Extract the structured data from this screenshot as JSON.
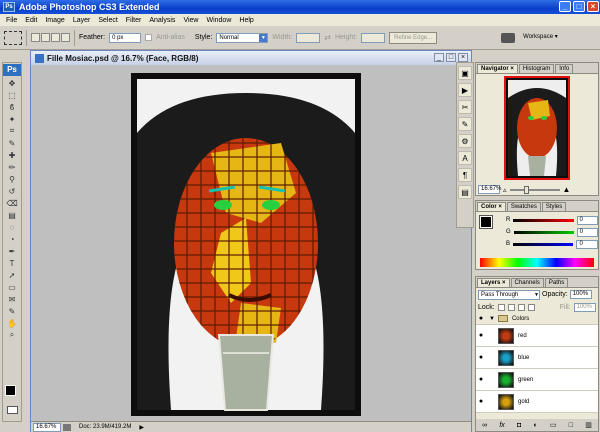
{
  "app": {
    "title": "Adobe Photoshop CS3 Extended",
    "logo": "Ps",
    "window_buttons": [
      "_",
      "□",
      "×"
    ]
  },
  "menu": [
    "File",
    "Edit",
    "Image",
    "Layer",
    "Select",
    "Filter",
    "Analysis",
    "View",
    "Window",
    "Help"
  ],
  "options": {
    "feather_label": "Feather:",
    "feather_value": "0 px",
    "antialias_label": "Anti-alias",
    "style_label": "Style:",
    "style_value": "Normal",
    "width_label": "Width:",
    "height_label": "Height:",
    "refine_edge": "Refine Edge...",
    "workspace": "Workspace ▾"
  },
  "document": {
    "title": "Fille Mosiac.psd @ 16.7% (Face, RGB/8)",
    "zoom": "16.67%",
    "doc_size": "Doc: 23.9M/419.2M"
  },
  "navigator": {
    "tabs": [
      "Navigator ×",
      "Histogram",
      "Info"
    ],
    "zoom": "16.67%"
  },
  "color": {
    "tabs": [
      "Color ×",
      "Swatches",
      "Styles"
    ],
    "channels": [
      {
        "label": "R",
        "value": "0"
      },
      {
        "label": "G",
        "value": "0"
      },
      {
        "label": "B",
        "value": "0"
      }
    ],
    "colors": {
      "r_track": "#cc1111",
      "g_track": "#119911",
      "b_track": "#1111cc"
    }
  },
  "layers": {
    "tabs": [
      "Layers ×",
      "Channels",
      "Paths"
    ],
    "blend_mode": "Pass Through",
    "opacity_label": "Opacity:",
    "opacity_value": "100%",
    "lock_label": "Lock:",
    "fill_label": "Fill:",
    "fill_value": "100%",
    "group_name": "Colors",
    "items": [
      {
        "name": "red",
        "color": "#c23a10"
      },
      {
        "name": "blue",
        "color": "#1aa0c8"
      },
      {
        "name": "green",
        "color": "#18b030"
      },
      {
        "name": "gold",
        "color": "#d8a010"
      }
    ]
  },
  "toolbox_icons": [
    "move-icon",
    "marquee-icon",
    "lasso-icon",
    "magic-wand-icon",
    "crop-icon",
    "eyedropper-icon",
    "healing-icon",
    "brush-icon",
    "stamp-icon",
    "history-brush-icon",
    "eraser-icon",
    "gradient-icon",
    "blur-icon",
    "dodge-icon",
    "pen-icon",
    "type-icon",
    "path-select-icon",
    "shape-icon",
    "notes-icon",
    "eyedropper2-icon",
    "hand-icon",
    "zoom-icon"
  ],
  "side_icons": [
    "history-icon",
    "actions-icon",
    "tools-preset-icon",
    "brushes-icon",
    "clone-source-icon",
    "character-icon",
    "paragraph-icon",
    "layer-comps-icon"
  ]
}
